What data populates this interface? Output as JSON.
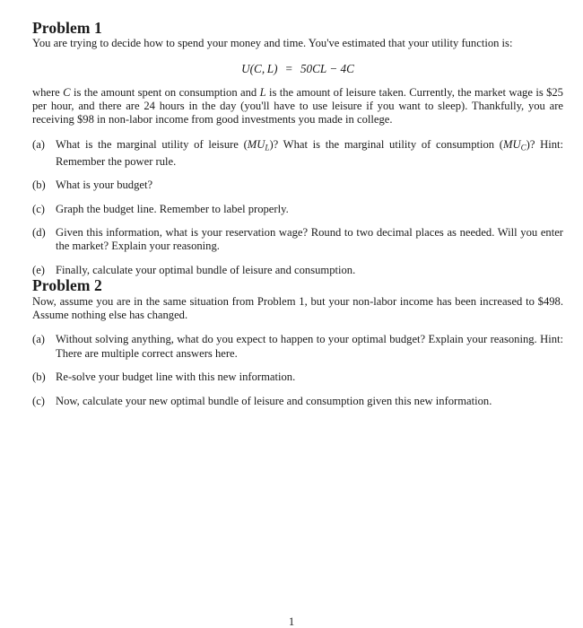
{
  "document": {
    "page_number": "1",
    "sections": [
      {
        "heading": "Problem 1",
        "intro": "You are trying to decide how to spend your money and time. You've estimated that your utility function is:",
        "equation": {
          "lhs_function": "U",
          "lhs_args": "(C, L)",
          "relation": "=",
          "rhs": "50CL − 4C",
          "plain": "U(C, L)  =  50CL − 4C"
        },
        "after_equation": "where C is the amount spent on consumption and L is the amount of leisure taken. Currently, the market wage is $25 per hour, and there are 24 hours in the day (you'll have to use leisure if you want to sleep). Thankfully, you are receiving $98 in non-labor income from good investments you made in college.",
        "items": [
          {
            "marker": "(a)",
            "text": "What is the marginal utility of leisure (MU_L)? What is the marginal utility of consumption (MU_C)? Hint: Remember the power rule."
          },
          {
            "marker": "(b)",
            "text": "What is your budget?"
          },
          {
            "marker": "(c)",
            "text": "Graph the budget line. Remember to label properly."
          },
          {
            "marker": "(d)",
            "text": "Given this information, what is your reservation wage? Round to two decimal places as needed. Will you enter the market? Explain your reasoning."
          },
          {
            "marker": "(e)",
            "text": "Finally, calculate your optimal bundle of leisure and consumption."
          }
        ]
      },
      {
        "heading": "Problem 2",
        "intro": "Now, assume you are in the same situation from Problem 1, but your non-labor income has been increased to $498. Assume nothing else has changed.",
        "items": [
          {
            "marker": "(a)",
            "text": "Without solving anything, what do you expect to happen to your optimal budget? Explain your reasoning. Hint: There are multiple correct answers here."
          },
          {
            "marker": "(b)",
            "text": "Re-solve your budget line with this new information."
          },
          {
            "marker": "(c)",
            "text": "Now, calculate your new optimal bundle of leisure and consumption given this new information."
          }
        ]
      }
    ]
  },
  "symbols": {
    "variable_C": "C",
    "variable_L": "L",
    "mu_leisure": "MU",
    "mu_leisure_sub": "L",
    "mu_consumption": "MU",
    "mu_consumption_sub": "C"
  },
  "colors": {
    "page_background": "#ffffff",
    "text": "#1a1a1a"
  }
}
